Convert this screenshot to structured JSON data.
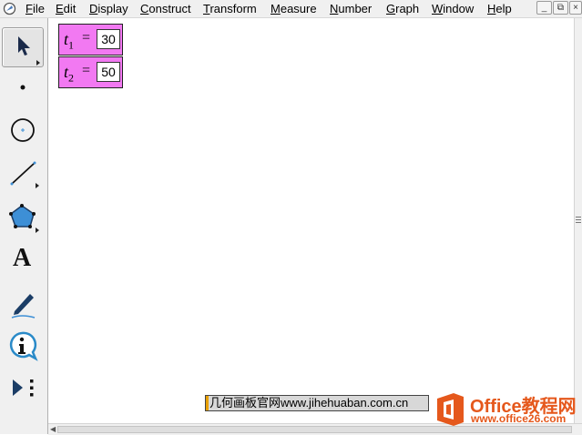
{
  "menu": {
    "items": [
      {
        "ul": "F",
        "rest": "ile"
      },
      {
        "ul": "E",
        "rest": "dit"
      },
      {
        "ul": "D",
        "rest": "isplay"
      },
      {
        "ul": "C",
        "rest": "onstruct"
      },
      {
        "ul": "T",
        "rest": "ransform"
      },
      {
        "ul": "M",
        "rest": "easure"
      },
      {
        "ul": "N",
        "rest": "umber"
      },
      {
        "ul": "G",
        "rest": "raph"
      },
      {
        "ul": "W",
        "rest": "indow"
      },
      {
        "ul": "H",
        "rest": "elp"
      }
    ],
    "window_buttons": [
      "_",
      "⧉",
      "×"
    ]
  },
  "toolbox": {
    "tools": [
      "selection-arrow",
      "point",
      "compass",
      "straightedge",
      "polygon",
      "text",
      "marker",
      "information",
      "custom"
    ],
    "selected": "selection-arrow",
    "text_tool_glyph": "A"
  },
  "parameters": [
    {
      "name": "t",
      "subscript": "1",
      "equals": "=",
      "value": "30"
    },
    {
      "name": "t",
      "subscript": "2",
      "equals": "=",
      "value": "50"
    }
  ],
  "watermark": {
    "banner": "几何画板官网www.jihehuaban.com.cn",
    "logo_title": "Office教程网",
    "logo_url": "www.office26.com"
  },
  "colors": {
    "parameter_fill": "#f279f2",
    "polygon_tool": "#3d8fd6",
    "logo_orange": "#e5581c"
  }
}
